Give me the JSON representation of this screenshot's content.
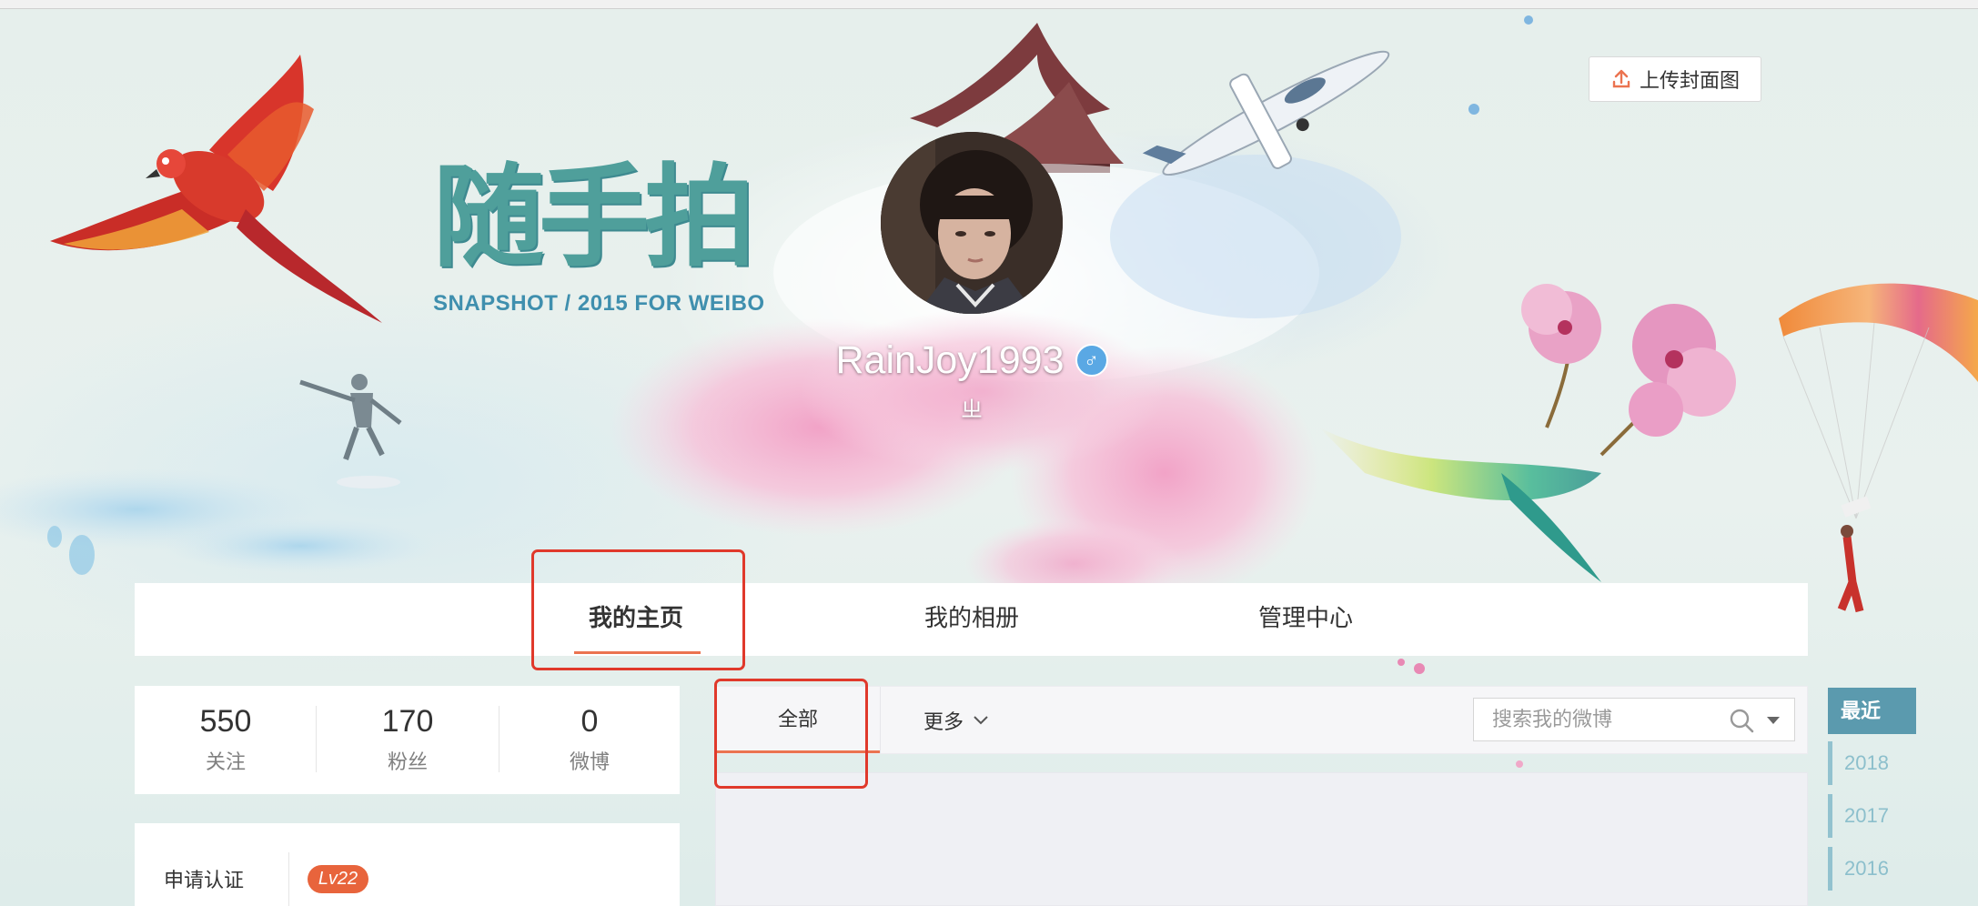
{
  "cover": {
    "upload_button_label": "上传封面图",
    "upload_icon": "upload-icon",
    "logo": {
      "title": "随手拍",
      "subtitle": "SNAPSHOT / 2015 FOR WEIBO"
    }
  },
  "profile": {
    "username": "RainJoy1993",
    "gender_icon": "male-icon",
    "gender_symbol": "♂",
    "bio": "ㄓ"
  },
  "nav": {
    "tabs": [
      {
        "label": "我的主页",
        "active": true
      },
      {
        "label": "我的相册",
        "active": false
      },
      {
        "label": "管理中心",
        "active": false
      }
    ]
  },
  "stats": [
    {
      "value": "550",
      "label": "关注"
    },
    {
      "value": "170",
      "label": "粉丝"
    },
    {
      "value": "0",
      "label": "微博"
    }
  ],
  "verify": {
    "label": "申请认证",
    "level_badge": "Lv22"
  },
  "feed": {
    "tabs": [
      {
        "label": "全部",
        "active": true
      }
    ],
    "more_label": "更多",
    "more_icon": "chevron-down-icon",
    "search": {
      "placeholder": "搜索我的微博",
      "icon": "search-icon",
      "dropdown_icon": "caret-down-icon"
    }
  },
  "timeline": {
    "recent_label": "最近",
    "years": [
      "2018",
      "2017",
      "2016"
    ]
  },
  "colors": {
    "accent": "#eb7350",
    "annotation": "#e0392b",
    "timeline": "#5b9aae",
    "level_badge": "#e8643c",
    "gender_icon": "#5aa8e4",
    "logo": "#4f9f9b"
  }
}
